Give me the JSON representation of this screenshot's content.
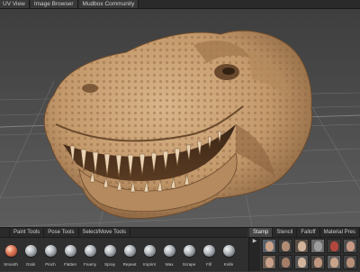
{
  "top_tabs": [
    "UV View",
    "Image Browser",
    "Mudbox Community"
  ],
  "tray": {
    "left_tabs": [
      {
        "label": "Paint Tools",
        "active": false
      },
      {
        "label": "Pose Tools",
        "active": false
      },
      {
        "label": "Select/Move Tools",
        "active": false
      }
    ],
    "right_tabs": [
      {
        "label": "Stamp",
        "active": true
      },
      {
        "label": "Stencil",
        "active": false
      },
      {
        "label": "Falloff",
        "active": false
      },
      {
        "label": "Material Pres",
        "active": false
      }
    ],
    "tools": [
      {
        "label": "Smooth",
        "icon": "smooth-brush-icon"
      },
      {
        "label": "Grab",
        "icon": "grab-brush-icon"
      },
      {
        "label": "Pinch",
        "icon": "pinch-brush-icon"
      },
      {
        "label": "Flatten",
        "icon": "flatten-brush-icon"
      },
      {
        "label": "Foamy",
        "icon": "foamy-brush-icon"
      },
      {
        "label": "Spray",
        "icon": "spray-brush-icon"
      },
      {
        "label": "Repeat",
        "icon": "repeat-brush-icon"
      },
      {
        "label": "Imprint",
        "icon": "imprint-brush-icon"
      },
      {
        "label": "Wax",
        "icon": "wax-brush-icon"
      },
      {
        "label": "Scrape",
        "icon": "scrape-brush-icon"
      },
      {
        "label": "Fill",
        "icon": "fill-brush-icon"
      },
      {
        "label": "Knife",
        "icon": "knife-brush-icon"
      }
    ]
  },
  "viewport": {
    "model": "t-rex-skull-sculpt",
    "model_color": "#c49a6c"
  },
  "colors": {
    "model_shadow": "#6b4a2c",
    "tray_bg": "#2f2f2f",
    "viewport_bg": "#4a4a4a"
  }
}
